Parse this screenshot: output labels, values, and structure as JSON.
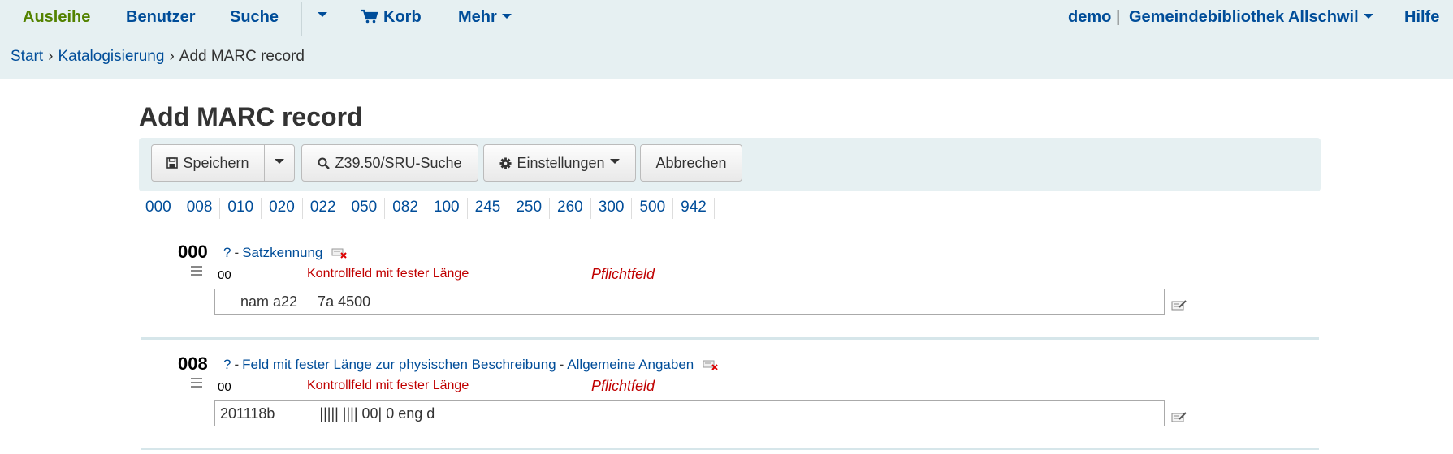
{
  "nav": {
    "circulation": "Ausleihe",
    "patrons": "Benutzer",
    "search": "Suche",
    "cart": "Korb",
    "more": "Mehr",
    "user": "demo",
    "divider": "|",
    "library": "Gemeindebibliothek Allschwil",
    "help": "Hilfe"
  },
  "breadcrumb": {
    "home": "Start",
    "cataloging": "Katalogisierung",
    "current": "Add MARC record",
    "separator": "›"
  },
  "page_title": "Add MARC record",
  "toolbar": {
    "save": "Speichern",
    "z3950": "Z39.50/SRU-Suche",
    "settings": "Einstellungen",
    "cancel": "Abbrechen"
  },
  "tags": [
    "000",
    "008",
    "010",
    "020",
    "022",
    "050",
    "082",
    "100",
    "245",
    "250",
    "260",
    "300",
    "500",
    "942"
  ],
  "fields": [
    {
      "tag": "000",
      "help": "?",
      "dash": "-",
      "description": "Satzkennung",
      "description_extra": "",
      "subfield_code": "00",
      "subfield_desc": "Kontrollfeld mit fester Länge",
      "mandatory": "Pflichtfeld",
      "value": "     nam a22     7a 4500"
    },
    {
      "tag": "008",
      "help": "?",
      "dash": "-",
      "description": "Feld mit fester Länge zur physischen Beschreibung",
      "description_extra": "Allgemeine Angaben",
      "subfield_code": "00",
      "subfield_desc": "Kontrollfeld mit fester Länge",
      "mandatory": "Pflichtfeld",
      "value": "201118b           ||||| |||| 00| 0 eng d"
    }
  ],
  "colors": {
    "header_bg": "#e6f0f2",
    "link": "#004d99",
    "active_nav": "#538200",
    "mandatory": "#c00000"
  }
}
